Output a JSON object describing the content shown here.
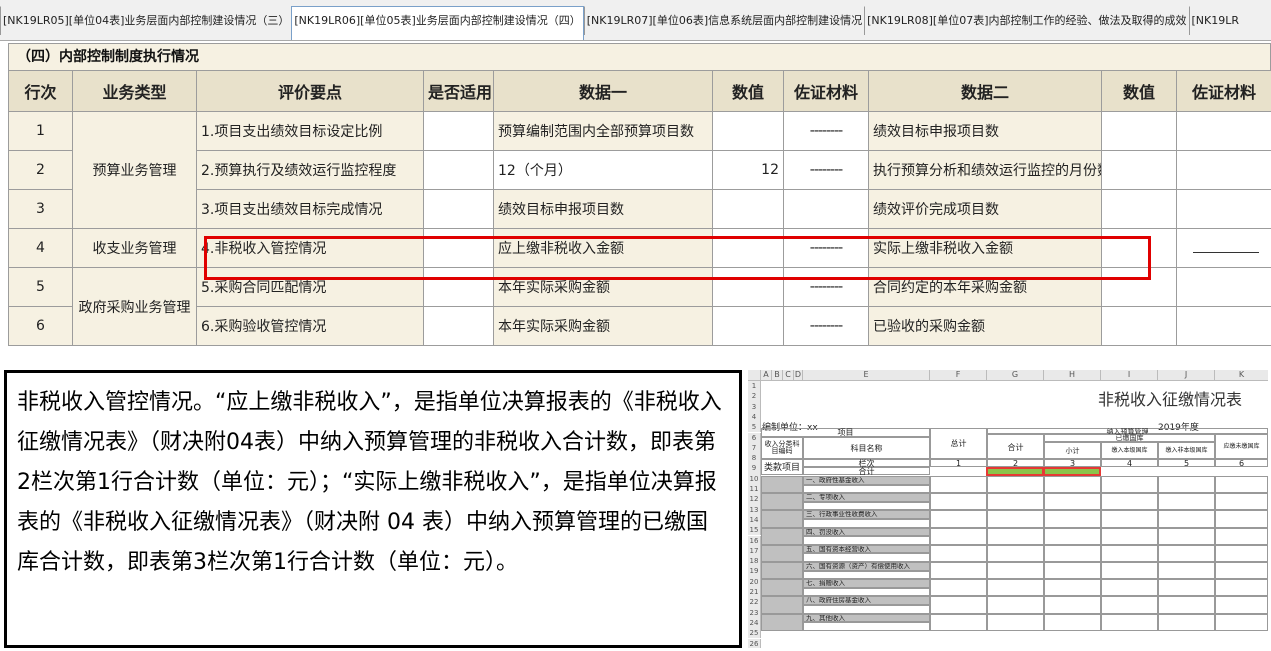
{
  "tabs": [
    {
      "label": "[NK19LR05][单位04表]业务层面内部控制建设情况（三）",
      "active": false
    },
    {
      "label": "[NK19LR06][单位05表]业务层面内部控制建设情况（四）",
      "active": true
    },
    {
      "label": "[NK19LR07][单位06表]信息系统层面内部控制建设情况",
      "active": false
    },
    {
      "label": "[NK19LR08][单位07表]内部控制工作的经验、做法及取得的成效",
      "active": false
    },
    {
      "label": "[NK19LR",
      "active": false
    }
  ],
  "section_title": "（四）内部控制制度执行情况",
  "headers": [
    "行次",
    "业务类型",
    "评价要点",
    "是否适用",
    "数据一",
    "数值",
    "佐证材料",
    "数据二",
    "数值",
    "佐证材料"
  ],
  "rows": [
    {
      "no": "1",
      "item": "1.项目支出绩效目标设定比例",
      "data1": "预算编制范围内全部预算项目数",
      "val1": "",
      "ev1": "--------",
      "data2": "绩效目标申报项目数"
    },
    {
      "no": "2",
      "item": "2.预算执行及绩效运行监控程度",
      "data1": "12（个月）",
      "val1": "12",
      "ev1": "--------",
      "data2": "执行预算分析和绩效运行监控的月份数"
    },
    {
      "no": "3",
      "item": "3.项目支出绩效目标完成情况",
      "data1": "绩效目标申报项目数",
      "val1": "",
      "ev1": "",
      "data2": "绩效评价完成项目数"
    },
    {
      "no": "4",
      "item": "4.非税收入管控情况",
      "data1": "应上缴非税收入金额",
      "val1": "",
      "ev1": "--------",
      "data2": "实际上缴非税收入金额"
    },
    {
      "no": "5",
      "item": "5.采购合同匹配情况",
      "data1": "本年实际采购金额",
      "val1": "",
      "ev1": "--------",
      "data2": "合同约定的本年采购金额"
    },
    {
      "no": "6",
      "item": "6.采购验收管控情况",
      "data1": "本年实际采购金额",
      "val1": "",
      "ev1": "--------",
      "data2": "已验收的采购金额"
    }
  ],
  "business_types": [
    "预算业务管理",
    "收支业务管理",
    "政府采购业务管理"
  ],
  "explanation": "非税收入管控情况。“应上缴非税收入”，是指单位决算报表的《非税收入征缴情况表》（财决附04表）中纳入预算管理的非税收入合计数，即表第2栏次第1行合计数（单位：元）；“实际上缴非税收入”，是指单位决算报表的《非税收入征缴情况表》（财决附 04 表）中纳入预算管理的已缴国库合计数，即表第3栏次第1行合计数（单位：元）。",
  "sheet": {
    "columns": [
      "A",
      "B",
      "C",
      "D",
      "E",
      "F",
      "G",
      "H",
      "I",
      "J",
      "K"
    ],
    "title": "非税收入征缴情况表",
    "unit": "编制单位：xx",
    "year": "2019年度",
    "h_item": "项目",
    "h_code": "收入分类科目编码",
    "h_name": "科目名称",
    "h_total": "总计",
    "h_budget": "纳入预算管理",
    "h_paid": "已缴国库",
    "h_sum": "合计",
    "h_sub": "小计",
    "h_level1": "缴入本级国库",
    "h_level2": "缴入非本级国库",
    "h_unpaid": "应缴未缴国库",
    "h_cls": "类款项目",
    "h_col": "栏次",
    "col_nums": [
      "1",
      "2",
      "3",
      "4",
      "5",
      "6"
    ],
    "total_label": "合计",
    "items": [
      "一、政府性基金收入",
      "二、专项收入",
      "三、行政事业性收费收入",
      "四、罚没收入",
      "五、国有资本经营收入",
      "六、国有资源（资产）有偿使用收入",
      "七、捐赠收入",
      "八、政府住房基金收入",
      "九、其他收入"
    ],
    "row_nums": [
      "1",
      "2",
      "3",
      "4",
      "5",
      "6",
      "7",
      "8",
      "9",
      "10",
      "11",
      "12",
      "13",
      "14",
      "15",
      "16",
      "17",
      "18",
      "19",
      "20",
      "21",
      "22",
      "23",
      "24",
      "25",
      "26"
    ]
  },
  "colors": {
    "highlight": "#e00000",
    "header_bg": "#e8e1cb",
    "green": "#8bc34a"
  }
}
